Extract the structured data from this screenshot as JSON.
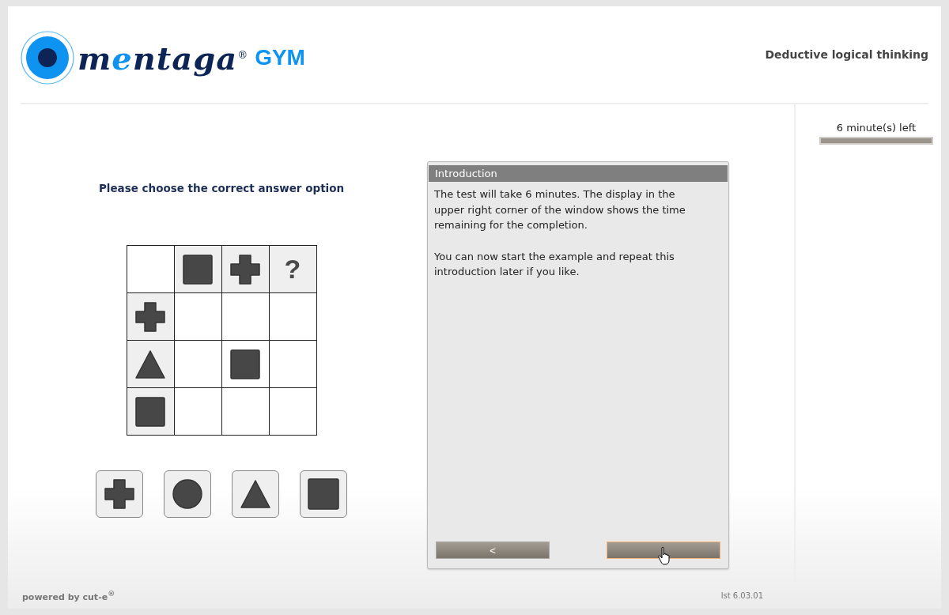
{
  "logo": {
    "parts": [
      {
        "text": "m",
        "accent": false
      },
      {
        "text": "e",
        "accent": true
      },
      {
        "text": "ntaga$^{®}$",
        "accent": false
      }
    ],
    "suffix": "GYM"
  },
  "test_name": "Deductive logical thinking",
  "instruction": "Please choose the correct answer option",
  "matrix": [
    [
      {
        "kind": "empty",
        "header": false
      },
      {
        "kind": "square",
        "header": true
      },
      {
        "kind": "cross",
        "header": true
      },
      {
        "kind": "question",
        "header": true,
        "text": "?"
      }
    ],
    [
      {
        "kind": "cross",
        "header": true
      },
      {
        "kind": "empty",
        "header": false
      },
      {
        "kind": "empty",
        "header": false
      },
      {
        "kind": "empty",
        "header": false
      }
    ],
    [
      {
        "kind": "triangle",
        "header": true
      },
      {
        "kind": "empty",
        "header": false
      },
      {
        "kind": "square",
        "header": false
      },
      {
        "kind": "empty",
        "header": false
      }
    ],
    [
      {
        "kind": "square",
        "header": true
      },
      {
        "kind": "empty",
        "header": false
      },
      {
        "kind": "empty",
        "header": false
      },
      {
        "kind": "empty",
        "header": false
      }
    ]
  ],
  "options": [
    {
      "kind": "cross"
    },
    {
      "kind": "circle"
    },
    {
      "kind": "triangle"
    },
    {
      "kind": "square"
    }
  ],
  "dialog": {
    "title": "Introduction",
    "paragraphs": [
      "The test will take 6 minutes. The display in the upper right corner of the window shows the time remaining for the completion.",
      "You can now start the example and repeat this introduction later if you like."
    ],
    "buttons": [
      {
        "kind": "back",
        "label": "<",
        "focused": false
      },
      {
        "kind": "next",
        "focused": true
      }
    ]
  },
  "timer": {
    "label": "6 minute(s) left",
    "level": 1
  },
  "footer": {
    "powered": "powered by cut-e$^{®}$",
    "version": "lst 6.03.01"
  }
}
